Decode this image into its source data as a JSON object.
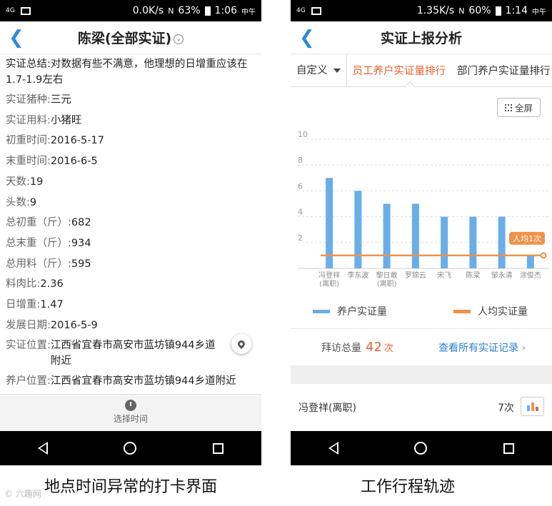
{
  "left": {
    "status": {
      "signal": "4G",
      "speed": "0.0K/s",
      "nfc": "N",
      "battery": "63%",
      "time": "1:06",
      "ampm": "中午"
    },
    "title": "陈梁(全部实证)",
    "fields": [
      {
        "label": "实证总结:",
        "value": "对数据有些不满意，他理想的日增重应该在1.7-1.9左右"
      },
      {
        "label": "实证猪种:",
        "value": "三元"
      },
      {
        "label": "实证用料:",
        "value": "小猪旺"
      },
      {
        "label": "初重时间:",
        "value": "2016-5-17"
      },
      {
        "label": "末重时间:",
        "value": "2016-6-5"
      },
      {
        "label": "天数:",
        "value": "19"
      },
      {
        "label": "头数:",
        "value": "9"
      },
      {
        "label": "总初重（斤）:",
        "value": "682"
      },
      {
        "label": "总末重（斤）:",
        "value": "934"
      },
      {
        "label": "总用料（斤）:",
        "value": "595"
      },
      {
        "label": "料肉比:",
        "value": "2.36"
      },
      {
        "label": "日增重:",
        "value": "1.47"
      },
      {
        "label": "发展日期:",
        "value": "2016-5-9"
      },
      {
        "label": "实证位置:",
        "value": "江西省宜春市高安市蓝坊镇944乡道附近"
      },
      {
        "label": "养户位置:",
        "value": "江西省宜春市高安市蓝坊镇944乡道附近"
      }
    ],
    "bottom_label": "选择时间",
    "caption": "地点时间异常的打卡界面"
  },
  "right": {
    "status": {
      "signal": "4G",
      "speed": "1.35K/s",
      "nfc": "N",
      "battery": "60%",
      "time": "1:14",
      "ampm": "中午"
    },
    "title": "实证上报分析",
    "tabs": {
      "custom": "自定义",
      "active": "员工养户实证量排行",
      "dept": "部门养户实证量排行"
    },
    "fullscreen_label": "全屏",
    "legend": {
      "bar_label": "养户实证量",
      "line_label": "人均实证量"
    },
    "visit": {
      "label": "拜访总量",
      "count": "42",
      "unit": "次",
      "view_all": "查看所有实证记录"
    },
    "person": {
      "name": "冯登祥(离职)",
      "count": "7次"
    },
    "caption": "工作行程轨迹"
  },
  "watermark": "© 六趣网",
  "chart_data": {
    "type": "bar",
    "categories": [
      "冯登祥(离职)",
      "李东波",
      "黎日敢(离职)",
      "罗锦云",
      "宋飞",
      "陈梁",
      "邹永清",
      "涂俊杰"
    ],
    "series": [
      {
        "name": "养户实证量",
        "values": [
          7,
          6,
          5,
          5,
          4,
          4,
          4,
          1
        ]
      }
    ],
    "line": {
      "name": "人均实证量",
      "value": 1,
      "annotation": "人均1次"
    },
    "ylim": [
      0,
      10
    ],
    "yticks": [
      2,
      4,
      6,
      8,
      10
    ],
    "colors": {
      "bar": "#6aaee8",
      "line": "#f0924a"
    }
  }
}
